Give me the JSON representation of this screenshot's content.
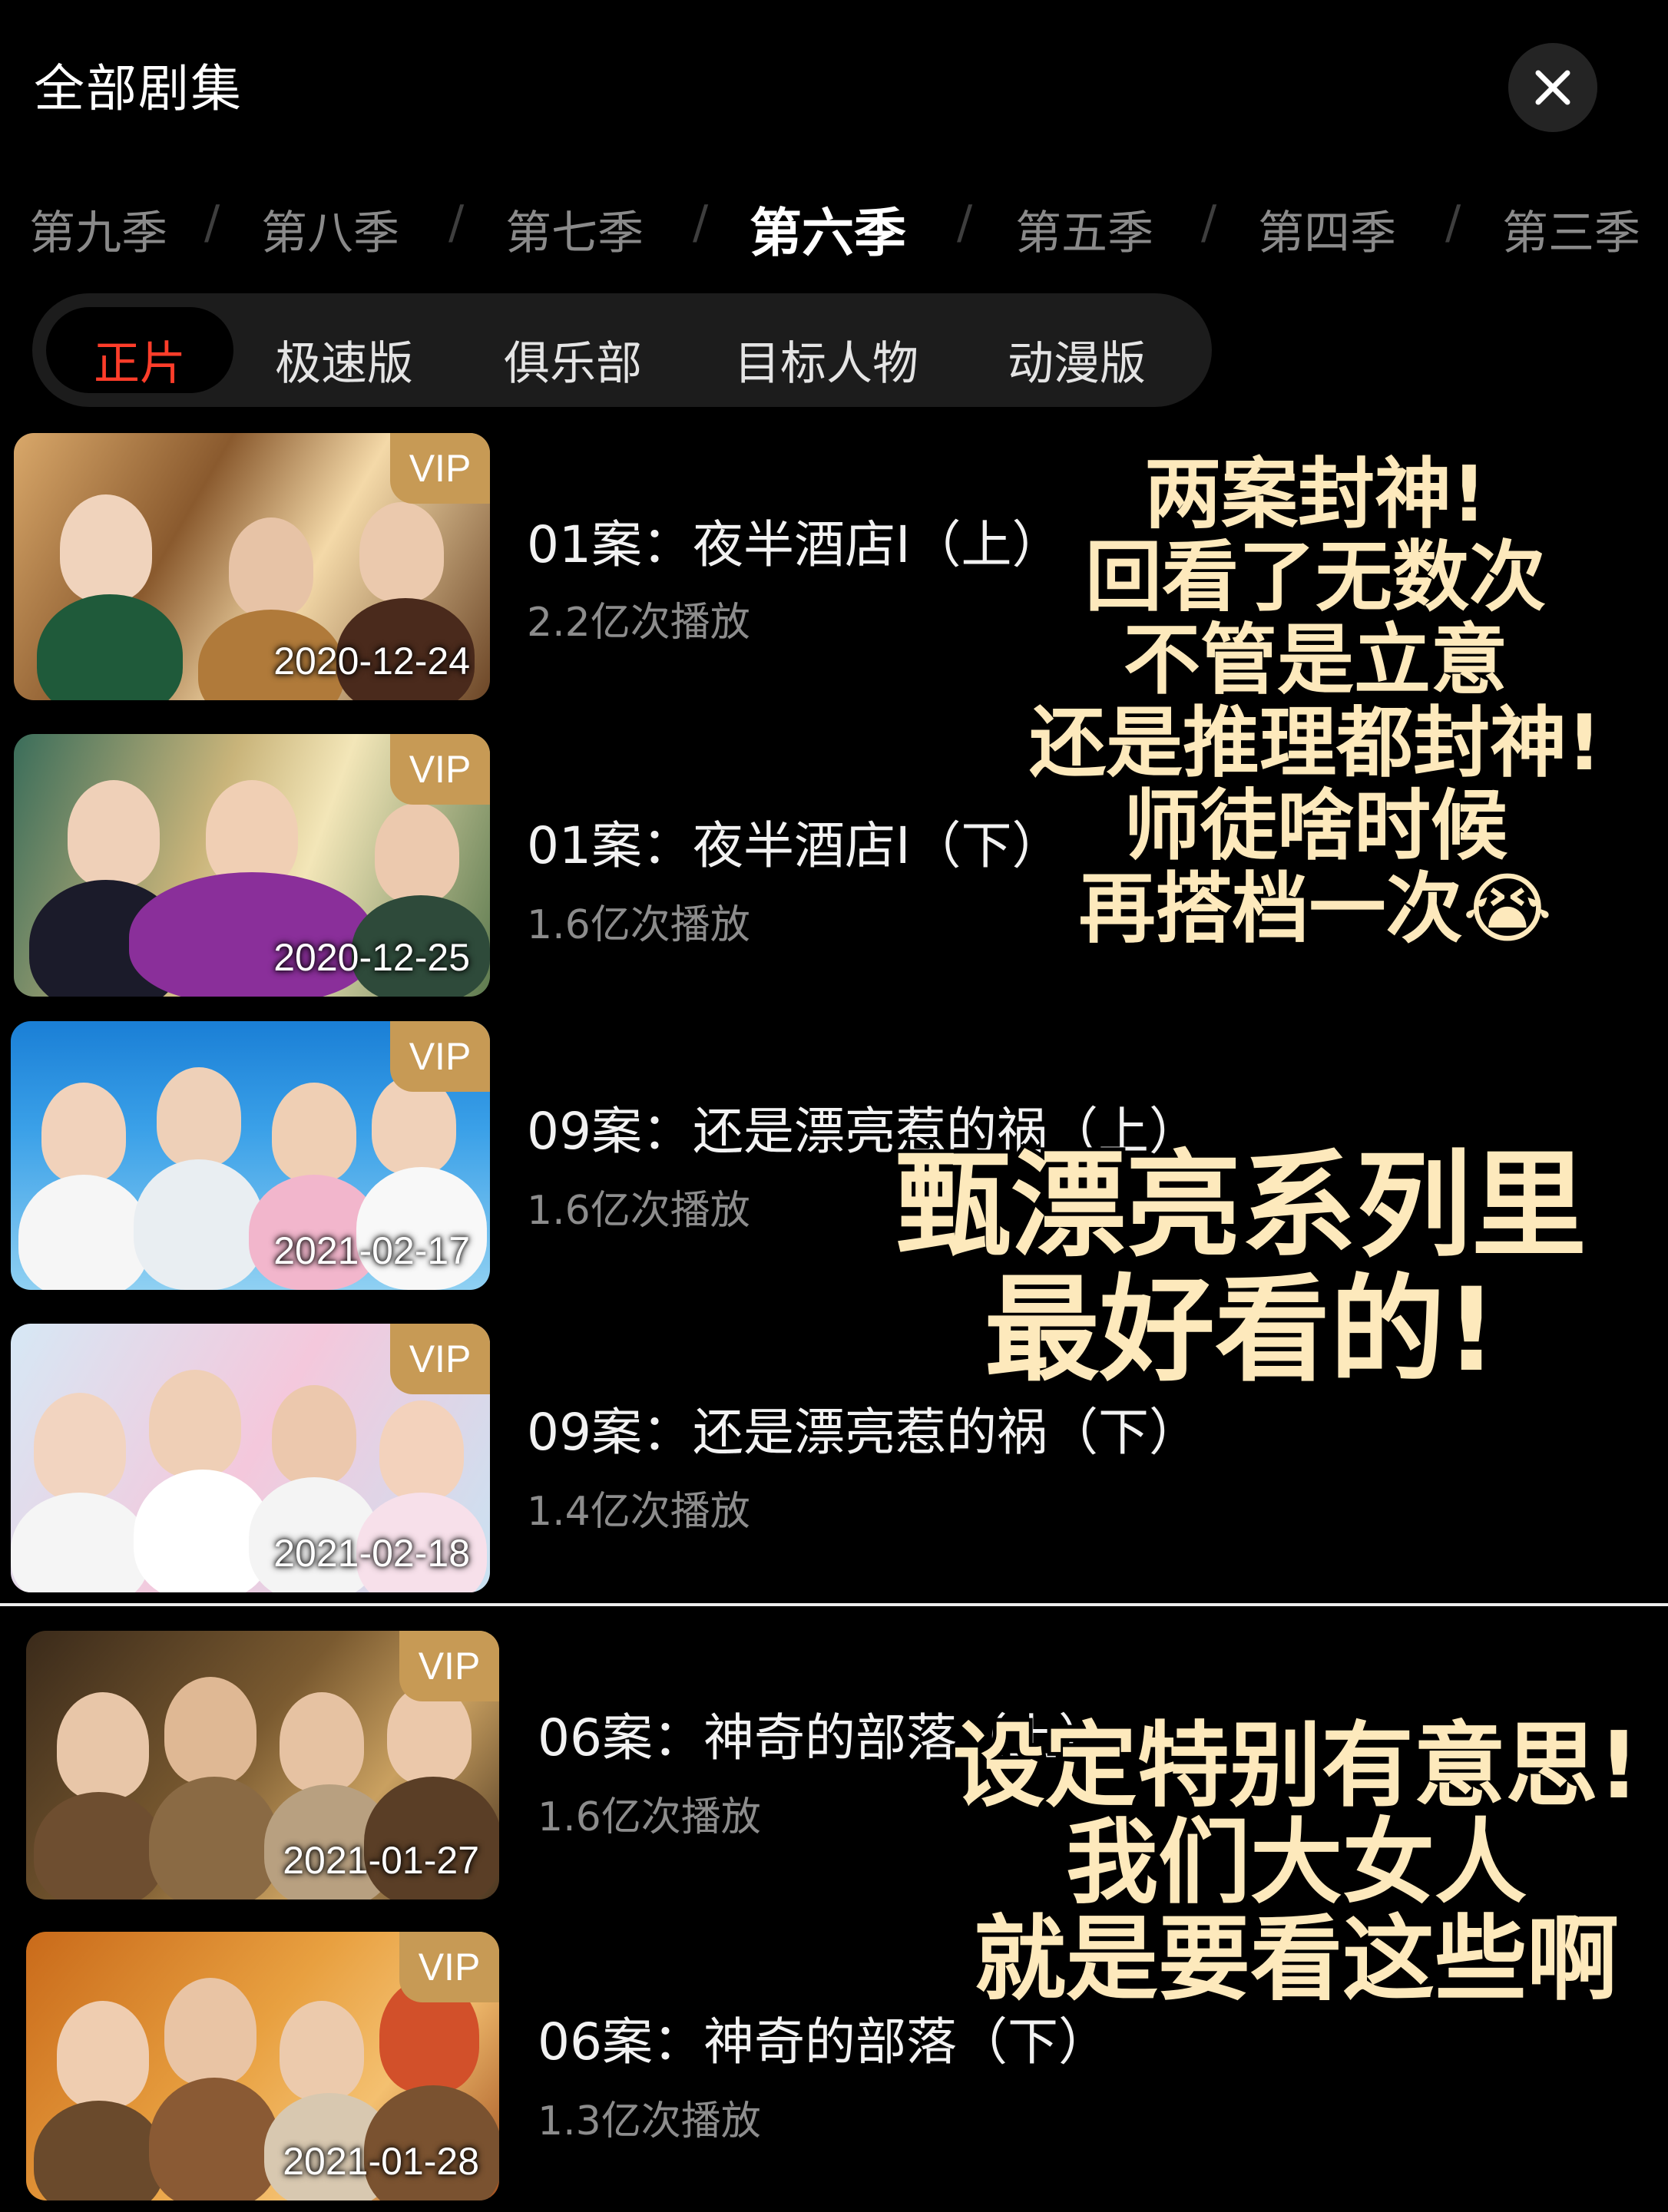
{
  "header": {
    "title": "全部剧集",
    "close_icon": "close-icon"
  },
  "seasons": [
    "第九季",
    "第八季",
    "第七季",
    "第六季",
    "第五季",
    "第四季",
    "第三季"
  ],
  "active_season": "第六季",
  "season_separator": "/",
  "subtabs": [
    "正片",
    "极速版",
    "俱乐部",
    "目标人物",
    "动漫版"
  ],
  "active_subtab": "正片",
  "colors": {
    "accent_red": "#ff3d2a",
    "vip_gold": "#c79a55",
    "note_cream": "#fde9bc"
  },
  "episodes": [
    {
      "title": "01案：夜半酒店I（上）",
      "plays": "2.2亿次播放",
      "date": "2020-12-24",
      "badge": "VIP"
    },
    {
      "title": "01案：夜半酒店I（下）",
      "plays": "1.6亿次播放",
      "date": "2020-12-25",
      "badge": "VIP"
    },
    {
      "title": "09案：还是漂亮惹的祸（上）",
      "plays": "1.6亿次播放",
      "date": "2021-02-17",
      "badge": "VIP"
    },
    {
      "title": "09案：还是漂亮惹的祸（下）",
      "plays": "1.4亿次播放",
      "date": "2021-02-18",
      "badge": "VIP"
    },
    {
      "title": "06案：神奇的部落（上）",
      "plays": "1.6亿次播放",
      "date": "2021-01-27",
      "badge": "VIP"
    },
    {
      "title": "06案：神奇的部落（下）",
      "plays": "1.3亿次播放",
      "date": "2021-01-28",
      "badge": "VIP"
    }
  ],
  "notes": [
    [
      "两案封神!",
      "回看了无数次",
      "不管是立意",
      "还是推理都封神!",
      "师徒啥时候",
      "再搭档一次😭"
    ],
    [
      "甄漂亮系列里",
      "最好看的!"
    ],
    [
      "设定特别有意思!",
      "我们大女人",
      "就是要看这些啊"
    ]
  ]
}
